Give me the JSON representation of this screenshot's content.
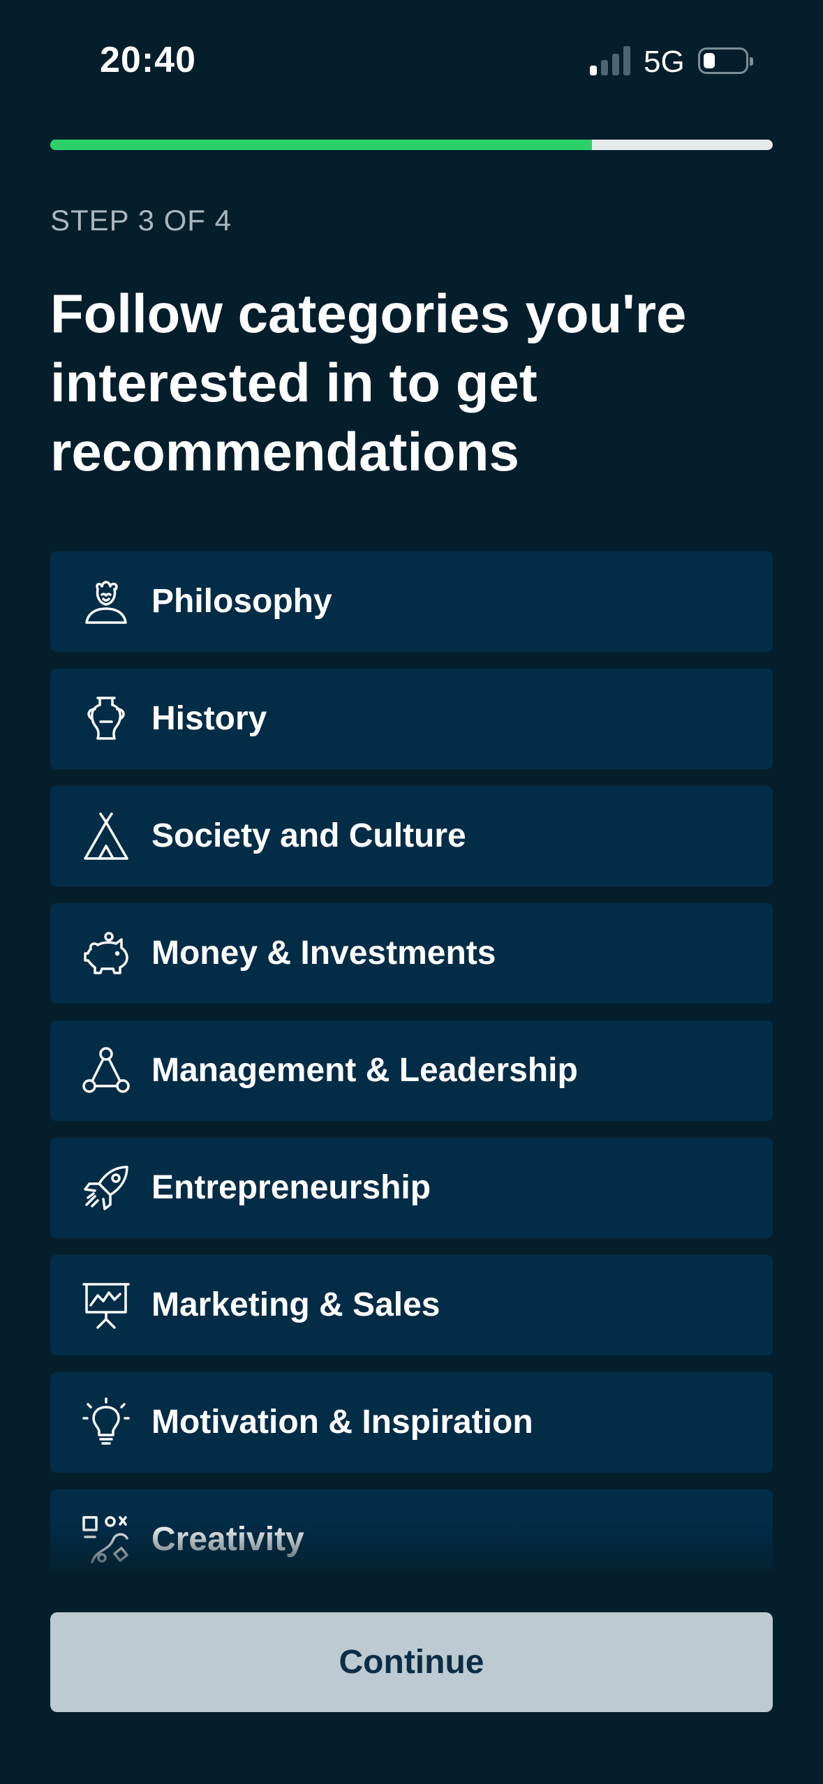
{
  "status_bar": {
    "time": "20:40",
    "network": "5G",
    "signal_bars_active": 1,
    "signal_bars_total": 4,
    "battery_level_fraction": 0.2
  },
  "progress": {
    "fraction": 0.75,
    "fill_color": "#2bd168",
    "track_color": "#e6e9eb"
  },
  "step_label": "STEP 3 OF 4",
  "title": "Follow categories you're interested in to get recommendations",
  "categories": [
    {
      "label": "Philosophy",
      "icon": "philosopher-bust-icon"
    },
    {
      "label": "History",
      "icon": "amphora-vase-icon"
    },
    {
      "label": "Society and Culture",
      "icon": "teepee-tent-icon"
    },
    {
      "label": "Money & Investments",
      "icon": "piggy-bank-icon"
    },
    {
      "label": "Management & Leadership",
      "icon": "network-triangle-icon"
    },
    {
      "label": "Entrepreneurship",
      "icon": "rocket-icon"
    },
    {
      "label": "Marketing & Sales",
      "icon": "presentation-board-icon"
    },
    {
      "label": "Motivation & Inspiration",
      "icon": "lightbulb-icon"
    },
    {
      "label": "Creativity",
      "icon": "creative-shapes-icon"
    }
  ],
  "continue_label": "Continue",
  "colors": {
    "background": "#041e2b",
    "card": "#032c47",
    "button_disabled": "#bccbd1",
    "button_text": "#0b2d45"
  }
}
